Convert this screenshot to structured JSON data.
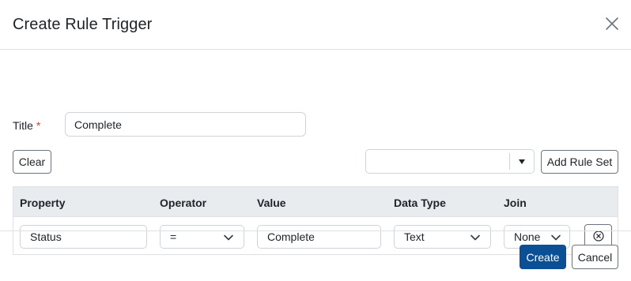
{
  "dialog": {
    "title": "Create Rule Trigger"
  },
  "form": {
    "title_label": "Title",
    "required_mark": "*",
    "title_value": "Complete"
  },
  "toolbar": {
    "clear_label": "Clear",
    "ruleset_value": "",
    "add_rule_set_label": "Add Rule Set"
  },
  "grid": {
    "columns": [
      "Property",
      "Operator",
      "Value",
      "Data Type",
      "Join"
    ],
    "rows": [
      {
        "property": "Status",
        "operator": "=",
        "value": "Complete",
        "data_type": "Text",
        "join": "None"
      }
    ]
  },
  "footer": {
    "create_label": "Create",
    "cancel_label": "Cancel"
  },
  "colors": {
    "primary": "#0b4f94",
    "required": "#dc3545",
    "header_bg": "#e9ecef"
  },
  "icons": {
    "close": "close-icon",
    "dropdown": "caret-down-icon",
    "chevron": "chevron-down-icon",
    "remove": "circle-x-icon"
  }
}
